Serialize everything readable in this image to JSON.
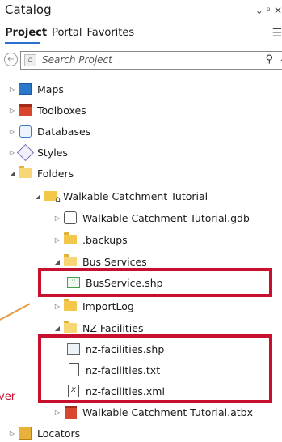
{
  "window": {
    "title": "Catalog",
    "controls": "⌄ ᵖ ✕"
  },
  "tabs": [
    {
      "label": "Project"
    },
    {
      "label": "Portal"
    },
    {
      "label": "Favorites"
    }
  ],
  "search": {
    "placeholder": "Search Project"
  },
  "tree": [
    {
      "label": "Maps"
    },
    {
      "label": "Toolboxes"
    },
    {
      "label": "Databases"
    },
    {
      "label": "Styles"
    },
    {
      "label": "Folders"
    },
    {
      "label": "Walkable Catchment Tutorial"
    },
    {
      "label": "Walkable Catchment Tutorial.gdb"
    },
    {
      "label": ".backups"
    },
    {
      "label": "Bus Services"
    },
    {
      "label": "BusService.shp"
    },
    {
      "label": "ImportLog"
    },
    {
      "label": "NZ Facilities"
    },
    {
      "label": "nz-facilities.shp"
    },
    {
      "label": "nz-facilities.txt"
    },
    {
      "label": "nz-facilities.xml"
    },
    {
      "label": "Walkable Catchment Tutorial.atbx"
    },
    {
      "label": "Locators"
    }
  ],
  "annotation": {
    "partial_text": "ver"
  },
  "colors": {
    "highlight": "#c8102e",
    "accent": "#2b6fd1"
  }
}
